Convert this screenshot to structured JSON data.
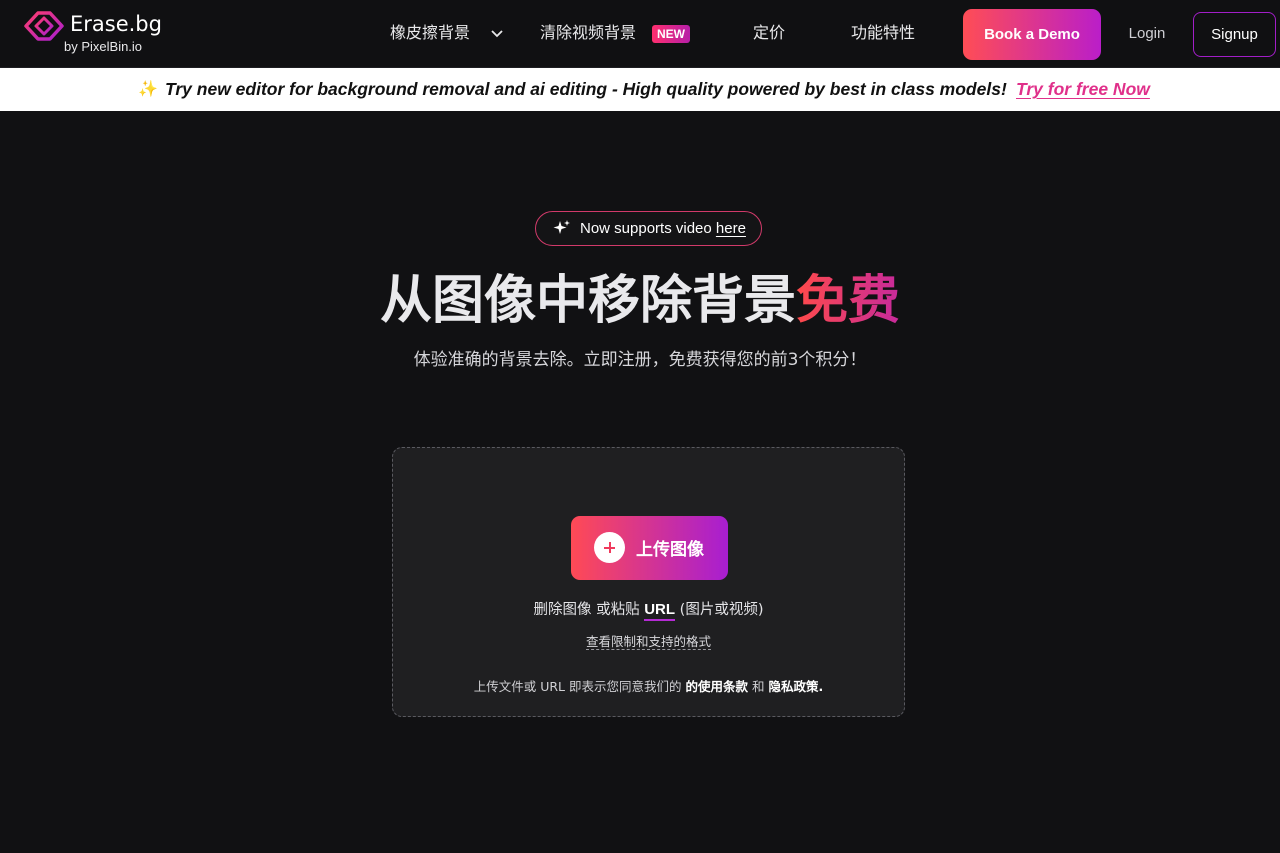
{
  "header": {
    "logo_main": "Erase.bg",
    "logo_sub": "by PixelBin.io",
    "nav": {
      "remove_bg": "橡皮擦背景",
      "remove_video_bg": "清除视频背景",
      "new_badge": "NEW",
      "pricing": "定价",
      "features": "功能特性"
    },
    "book_demo": "Book a Demo",
    "login": "Login",
    "signup": "Signup"
  },
  "banner": {
    "sparkle": "✨",
    "text": "Try new editor for background removal and ai editing - High quality powered by best in class models!",
    "link": "Try for free Now"
  },
  "hero": {
    "pill_text": "Now supports video",
    "pill_link": "here",
    "title_main": "从图像中移除背景",
    "title_accent": "免费",
    "subtitle": "体验准确的背景去除。立即注册，免费获得您的前3个积分！"
  },
  "upload": {
    "button_label": "上传图像",
    "drop_text": "删除图像 或粘贴",
    "url_link": "URL",
    "drop_suffix": "(图片或视频)",
    "limits_link": "查看限制和支持的格式",
    "terms_prefix": "上传文件或 URL 即表示您同意我们的",
    "terms_link": "的使用条款",
    "terms_and": "和",
    "privacy_link": "隐私政策",
    "terms_end": "."
  }
}
